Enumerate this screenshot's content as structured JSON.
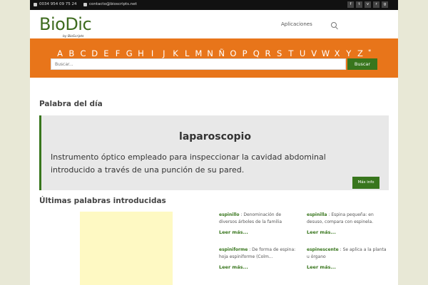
{
  "topbar": {
    "phone": "0034 954 09 75 24",
    "email": "contacto@bioscripts.net",
    "social_icons": [
      "facebook-icon",
      "twitter-icon",
      "vimeo-icon",
      "rss-icon",
      "googleplus-icon"
    ]
  },
  "header": {
    "logo": "BioDic",
    "logo_sub": "by BioScripts",
    "nav_apps": "Aplicaciones"
  },
  "alphabet": [
    "A",
    "B",
    "C",
    "D",
    "E",
    "F",
    "G",
    "H",
    "I",
    "J",
    "K",
    "L",
    "M",
    "N",
    "Ñ",
    "O",
    "P",
    "Q",
    "R",
    "S",
    "T",
    "U",
    "V",
    "W",
    "X",
    "Y",
    "Z",
    "*"
  ],
  "search": {
    "placeholder": "Buscar...",
    "button": "Buscar"
  },
  "word_of_day": {
    "heading": "Palabra del día",
    "word": "laparoscopio",
    "definition": "Instrumento óptico empleado para inspeccionar la cavidad abdominal introducido a través de una punción de su pared.",
    "more": "Más info"
  },
  "latest": {
    "heading": "Últimas palabras introducidas",
    "entries": [
      {
        "word": "espinillo",
        "def": " : Denominación de diversos árboles de la familia",
        "read": "Leer más..."
      },
      {
        "word": "espinilla",
        "def": " : Espina pequeña: en desuso, compara con espinela.",
        "read": "Leer más..."
      },
      {
        "word": "espiniforme",
        "def": " : De forma de espina: hoja espiniforme (Colm...",
        "read": "Leer más..."
      },
      {
        "word": "espinescente",
        "def": " : Se aplica a la planta u órgano",
        "read": "Leer más..."
      }
    ]
  },
  "colors": {
    "accent_orange": "#e8751a",
    "brand_green": "#38761d"
  }
}
